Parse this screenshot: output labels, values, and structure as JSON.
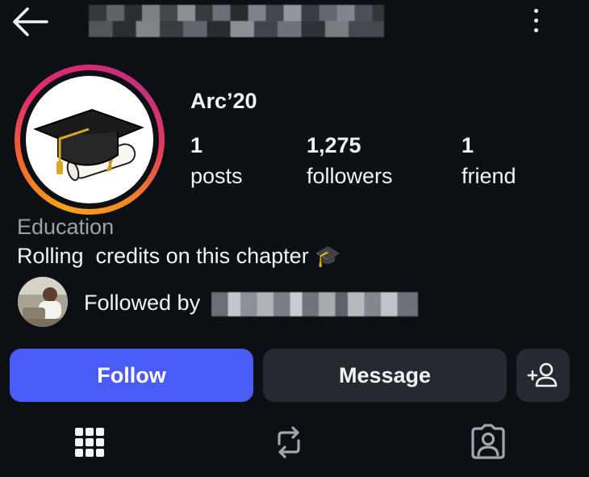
{
  "header": {
    "back_icon": "arrow-left-icon",
    "username": "",
    "more_icon": "more-vertical-icon"
  },
  "profile": {
    "name": "Arc’20",
    "avatar_icon": "graduation-cap-diploma",
    "ring_colors": [
      "#f7a21b",
      "#e52d6c",
      "#c5307f"
    ],
    "stats": [
      {
        "value": "1",
        "label": "posts"
      },
      {
        "value": "1,275",
        "label": "followers"
      },
      {
        "value": "1",
        "label": "friend"
      }
    ],
    "category": "Education",
    "bio": "Rolling  credits on this chapter",
    "bio_emoji": "🎓"
  },
  "followed_by": {
    "label": "Followed by"
  },
  "actions": {
    "follow_label": "Follow",
    "message_label": "Message",
    "add_friend_icon": "add-person-icon",
    "follow_color": "#4a5cf6"
  },
  "tabs": [
    {
      "icon": "grid-icon"
    },
    {
      "icon": "repost-icon"
    },
    {
      "icon": "tagged-person-icon"
    }
  ]
}
